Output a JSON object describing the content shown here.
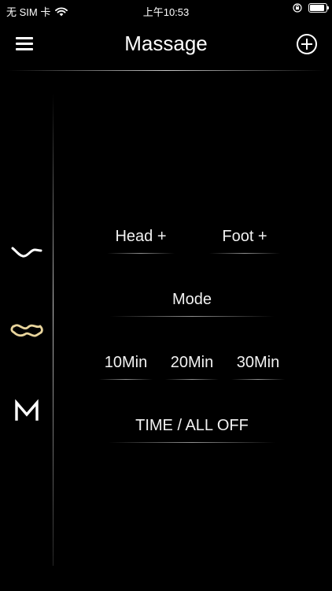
{
  "status_bar": {
    "carrier": "无 SIM 卡",
    "time": "上午10:53",
    "battery_level": 0.9
  },
  "header": {
    "title": "Massage",
    "menu_icon": "hamburger-menu-icon",
    "add_icon": "plus-circle-icon"
  },
  "side_nav": {
    "items": [
      {
        "icon": "recline-curve-icon",
        "active": false
      },
      {
        "icon": "wave-loop-icon",
        "active": true
      },
      {
        "icon": "letter-m-icon",
        "active": false
      }
    ]
  },
  "controls": {
    "head_plus": "Head +",
    "foot_plus": "Foot +",
    "mode": "Mode",
    "timer_10": "10Min",
    "timer_20": "20Min",
    "timer_30": "30Min",
    "all_off": "TIME / ALL OFF"
  },
  "colors": {
    "background": "#000000",
    "text": "#ffffff",
    "active_icon": "#e8d49c"
  }
}
